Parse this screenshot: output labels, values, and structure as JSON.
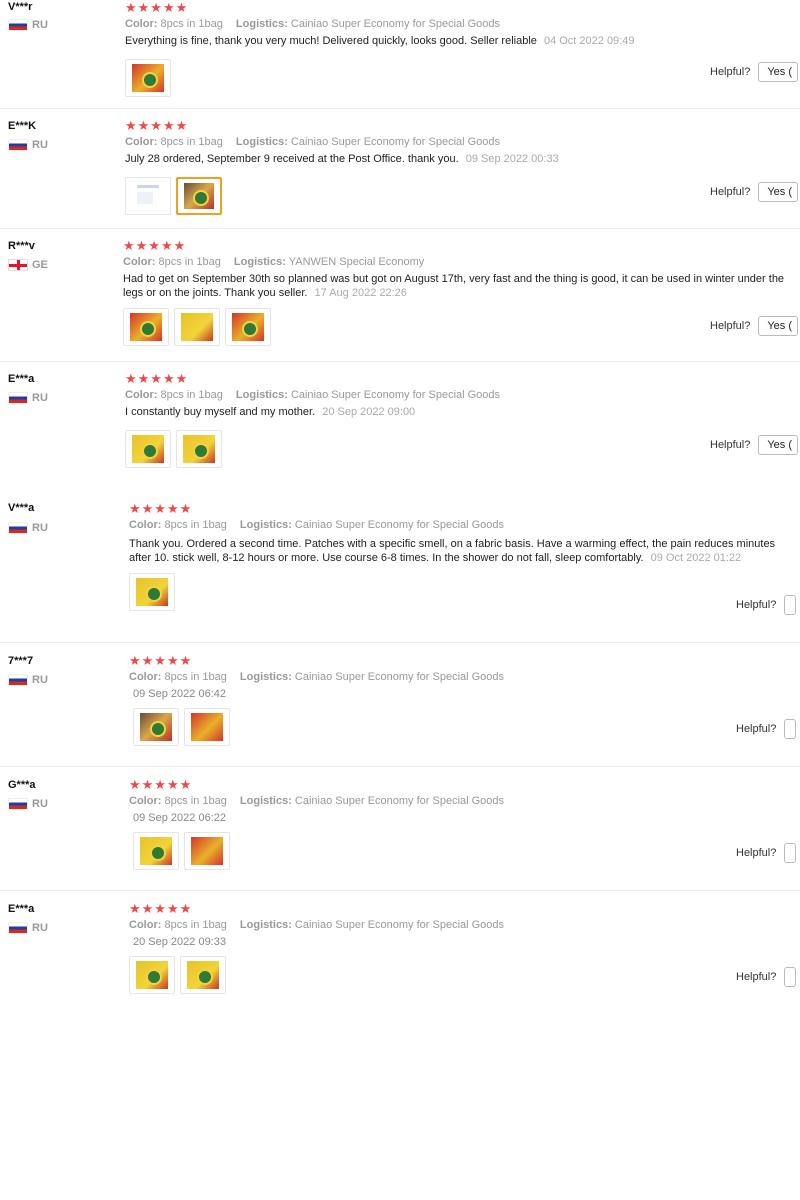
{
  "labels": {
    "color": "Color:",
    "logistics": "Logistics:",
    "helpful": "Helpful?",
    "yes": "Yes ("
  },
  "reviews": [
    {
      "user": "V***r",
      "country": "RU",
      "flag": "ru",
      "stars": 5,
      "color": "8pcs in 1bag",
      "logistics": "Cainiao Super Economy for Special Goods",
      "text": "Everything is fine, thank you very much! Delivered quickly, looks good. Seller reliable",
      "date": "04 Oct 2022 09:49",
      "images": [
        "photo-1"
      ],
      "helpful_yes": "Yes ("
    },
    {
      "user": "E***K",
      "country": "RU",
      "flag": "ru",
      "stars": 5,
      "color": "8pcs in 1bag",
      "logistics": "Cainiao Super Economy for Special Goods",
      "text": "July 28 ordered, September 9 received at the Post Office. thank you.",
      "date": "09 Sep 2022 00:33",
      "images": [
        "screenshot-1",
        "photo-2"
      ],
      "helpful_yes": "Yes ("
    },
    {
      "user": "R***v",
      "country": "GE",
      "flag": "ge",
      "stars": 5,
      "color": "8pcs in 1bag",
      "logistics": "YANWEN Special Economy",
      "text": "Had to get on September 30th so planned was but got on August 17th, very fast and the thing is good, it can be used in winter under the legs or on the joints. Thank you seller.",
      "date": "17 Aug 2022 22:26",
      "images": [
        "photo-1",
        "photo-2",
        "photo-3"
      ],
      "helpful_yes": "Yes ("
    },
    {
      "user": "E***a",
      "country": "RU",
      "flag": "ru",
      "stars": 5,
      "color": "8pcs in 1bag",
      "logistics": "Cainiao Super Economy for Special Goods",
      "text": "I constantly buy myself and my mother.",
      "date": "20 Sep 2022 09:00",
      "images": [
        "photo-1",
        "photo-2"
      ],
      "helpful_yes": "Yes ("
    },
    {
      "user": "V***a",
      "country": "RU",
      "flag": "ru",
      "stars": 5,
      "color": "8pcs in 1bag",
      "logistics": "Cainiao Super Economy for Special Goods",
      "text": "Thank you. Ordered a second time. Patches with a specific smell, on a fabric basis. Have a warming effect, the pain reduces minutes after 10. stick well, 8-12 hours or more. Use course 6-8 times. In the shower do not fall, sleep comfortably.",
      "date": "09 Oct 2022 01:22",
      "images": [
        "photo-1"
      ],
      "helpful_yes": ""
    },
    {
      "user": "7***7",
      "country": "RU",
      "flag": "ru",
      "stars": 5,
      "color": "8pcs in 1bag",
      "logistics": "Cainiao Super Economy for Special Goods",
      "text": "",
      "date": "09 Sep 2022 06:42",
      "images": [
        "photo-1",
        "photo-2"
      ],
      "helpful_yes": ""
    },
    {
      "user": "G***a",
      "country": "RU",
      "flag": "ru",
      "stars": 5,
      "color": "8pcs in 1bag",
      "logistics": "Cainiao Super Economy for Special Goods",
      "text": "",
      "date": "09 Sep 2022 06:22",
      "images": [
        "photo-1",
        "photo-2"
      ],
      "helpful_yes": ""
    },
    {
      "user": "E***a",
      "country": "RU",
      "flag": "ru",
      "stars": 5,
      "color": "8pcs in 1bag",
      "logistics": "Cainiao Super Economy for Special Goods",
      "text": "",
      "date": "20 Sep 2022 09:33",
      "images": [
        "photo-1",
        "photo-2"
      ],
      "helpful_yes": ""
    }
  ],
  "colors": {
    "star": "#f04848",
    "selected_thumb_border": "#f0a020"
  }
}
